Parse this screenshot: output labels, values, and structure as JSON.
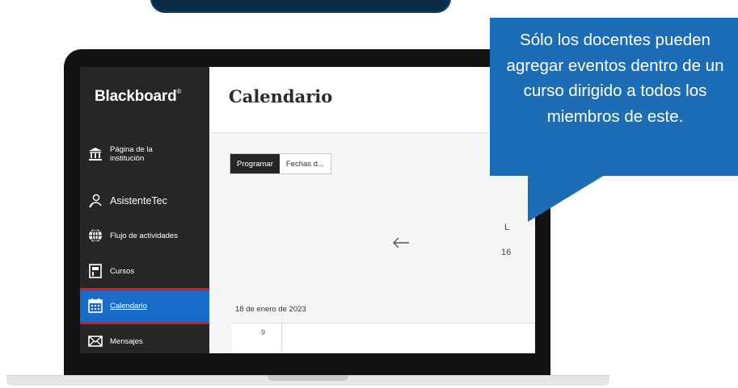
{
  "sidebar": {
    "brand": "Blackboard",
    "brand_mark": "®",
    "items": [
      {
        "label": "Página de la institución",
        "icon": "institution-icon"
      },
      {
        "label": "AsistenteTec",
        "icon": "user-icon"
      },
      {
        "label": "Flujo de actividades",
        "icon": "globe-icon"
      },
      {
        "label": "Cursos",
        "icon": "courses-icon"
      },
      {
        "label": "Calendario",
        "icon": "calendar-icon",
        "active": true
      },
      {
        "label": "Mensajes",
        "icon": "envelope-icon"
      }
    ]
  },
  "main": {
    "title": "Calendario",
    "tabs": [
      {
        "label": "Programar",
        "selected": true
      },
      {
        "label": "Fechas d..."
      }
    ],
    "day_letter": "L",
    "day_number": "16",
    "date_label": "18 de enero de 2023",
    "hour_label": "9"
  },
  "callout": {
    "text": "Sólo los docentes pueden agregar eventos dentro de un curso dirigido a todos los miembros de este."
  },
  "colors": {
    "sidebar_bg": "#262626",
    "active_item": "#1a6dc7",
    "highlight_outline": "#e3151a",
    "callout_bg": "#1d6db6",
    "banner_bg": "#0a2a45"
  }
}
